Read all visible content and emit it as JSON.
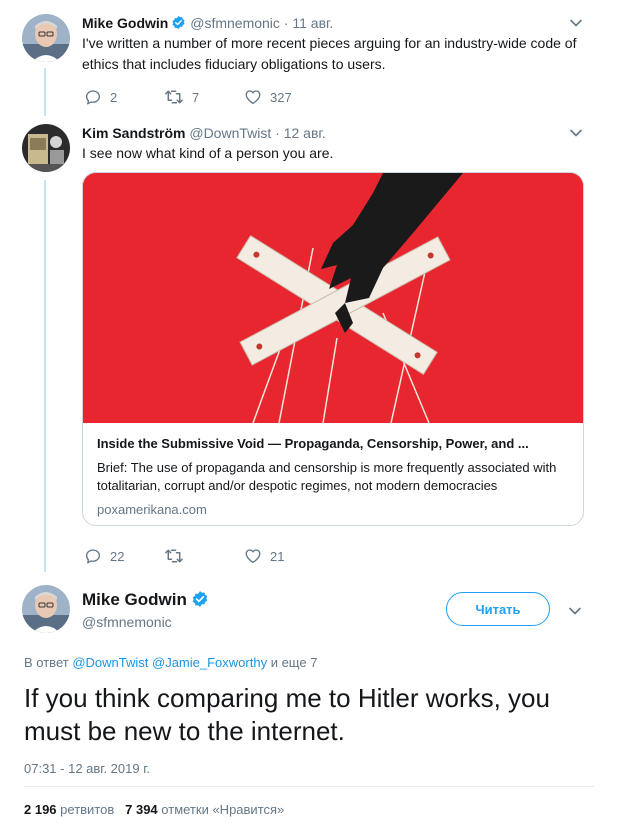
{
  "tweets": [
    {
      "name": "Mike Godwin",
      "handle": "@sfmnemonic",
      "separator": "·",
      "date": "11 авг.",
      "text": "I've written a number of more recent pieces arguing for an industry-wide code of ethics that includes fiduciary obligations to users.",
      "replies": "2",
      "retweets": "7",
      "likes": "327"
    },
    {
      "name": "Kim Sandström",
      "handle": "@DownTwist",
      "separator": "·",
      "date": "12 авг.",
      "text": "I see now what kind of a person you are.",
      "card": {
        "title": "Inside the Submissive Void — Propaganda, Censorship, Power, and ...",
        "description": "Brief: The use of propaganda and censorship is more frequently associated with totalitarian, corrupt and/or despotic regimes, not modern democracies",
        "domain": "poxamerikana.com"
      },
      "replies": "22",
      "retweets": "",
      "likes": "21"
    }
  ],
  "main_tweet": {
    "name": "Mike Godwin",
    "handle": "@sfmnemonic",
    "follow_label": "Читать",
    "reply_prefix": "В ответ",
    "reply_users": [
      "@DownTwist",
      "@Jamie_Foxworthy"
    ],
    "reply_suffix": "и еще 7",
    "text": "If you think comparing me to Hitler works, you must be new to the internet.",
    "timestamp": "07:31 - 12 авг. 2019 г.",
    "retweet_count": "2 196",
    "retweet_label": "ретвитов",
    "like_count": "7 394",
    "like_label": "отметки «Нравится»"
  },
  "colors": {
    "accent": "#1da1f2",
    "card_image_bg": "#e8262f",
    "thread_line": "#c4e3f3"
  },
  "icons": [
    "reply-icon",
    "retweet-icon",
    "like-icon",
    "verified-icon",
    "chevron-down-icon"
  ]
}
